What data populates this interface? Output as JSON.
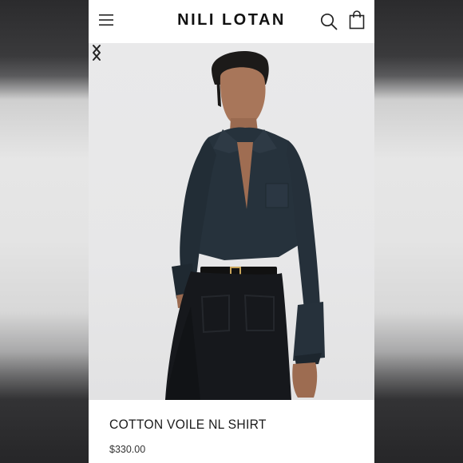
{
  "header": {
    "brand": "NILI LOTAN",
    "menu_icon": "hamburger-menu-icon",
    "search_icon": "search-icon",
    "bag_icon": "shopping-bag-icon"
  },
  "gallery": {
    "prev_icon": "chevron-left-icon",
    "next_icon": "chevron-right-icon"
  },
  "product": {
    "name": "COTTON VOILE NL SHIRT",
    "price": "$330.00"
  },
  "colors": {
    "page_bg": "#ffffff",
    "text": "#111111",
    "shirt": "#26323c",
    "pants": "#16181c"
  }
}
